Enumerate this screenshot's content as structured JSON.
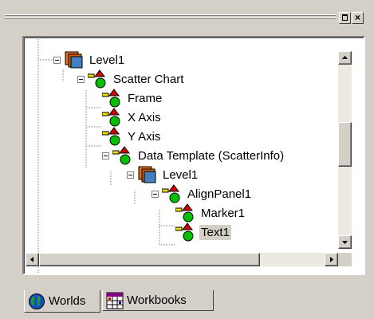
{
  "window": {
    "restore_label": "▫",
    "close_label": "×"
  },
  "tree": {
    "nodes": [
      {
        "label": "Level1",
        "icon": "level-icon"
      },
      {
        "label": "Scatter Chart",
        "icon": "chart-shapes-icon"
      },
      {
        "label": "Frame",
        "icon": "chart-shapes-icon"
      },
      {
        "label": "X Axis",
        "icon": "chart-shapes-icon"
      },
      {
        "label": "Y Axis",
        "icon": "chart-shapes-icon"
      },
      {
        "label": "Data Template (ScatterInfo)",
        "icon": "chart-shapes-icon"
      },
      {
        "label": "Level1",
        "icon": "level-icon"
      },
      {
        "label": "AlignPanel1",
        "icon": "chart-shapes-icon"
      },
      {
        "label": "Marker1",
        "icon": "chart-shapes-icon"
      },
      {
        "label": "Text1",
        "icon": "chart-shapes-icon",
        "selected": true
      }
    ]
  },
  "tabs": [
    {
      "label": "Worlds",
      "icon": "globe-icon",
      "active": true
    },
    {
      "label": "Workbooks",
      "icon": "workbook-icon",
      "active": false
    }
  ],
  "colors": {
    "face": "#d4d0c8",
    "selection": "#d4d0c8"
  }
}
